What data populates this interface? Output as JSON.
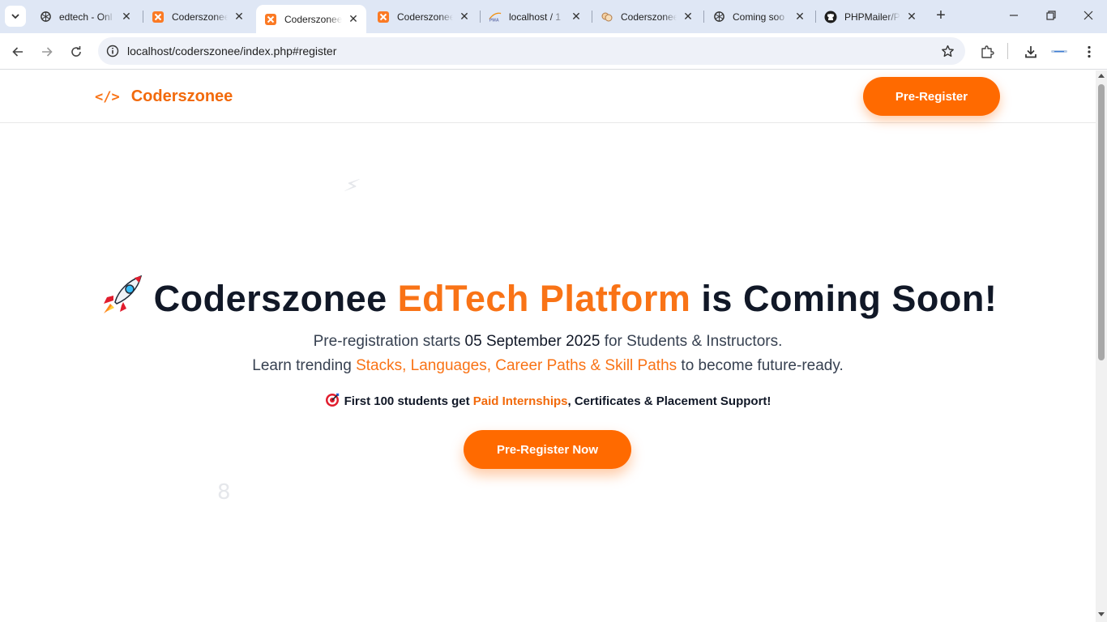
{
  "browser": {
    "tabs": [
      {
        "title": "edtech - Onl",
        "icon": "chatgpt-icon",
        "active": false
      },
      {
        "title": "Coderszonee",
        "icon": "xampp-icon",
        "active": false
      },
      {
        "title": "Coderszonee",
        "icon": "xampp-icon",
        "active": true
      },
      {
        "title": "Coderszonee",
        "icon": "xampp-icon",
        "active": false
      },
      {
        "title": "localhost / 1",
        "icon": "phpmyadmin-icon",
        "active": false
      },
      {
        "title": "Coderszonee",
        "icon": "brain-icon",
        "active": false
      },
      {
        "title": "Coming soo",
        "icon": "chatgpt-icon",
        "active": false
      },
      {
        "title": "PHPMailer/P",
        "icon": "github-icon",
        "active": false
      }
    ],
    "new_tab": "+",
    "url": "localhost/coderszonee/index.php#register"
  },
  "navbar": {
    "brand_icon": "</>",
    "brand_name": "Coderszonee",
    "cta": "Pre-Register"
  },
  "hero": {
    "title_prefix": "Coderszonee ",
    "title_accent": "EdTech Platform",
    "title_suffix": " is Coming Soon!",
    "line1_pre": "Pre-registration starts ",
    "line1_date": "05 September 2025",
    "line1_post": " for Students & Instructors.",
    "line2_pre": "Learn trending ",
    "line2_accent": "Stacks, Languages, Career Paths & Skill Paths",
    "line2_post": " to become future-ready.",
    "perk_pre": "First 100 students get ",
    "perk_accent": "Paid Internships",
    "perk_post": ", Certificates & Placement Support!",
    "cta": "Pre-Register Now"
  },
  "colors": {
    "accent": "#ff6a00",
    "heading": "#111827",
    "tabstrip": "#dfe7f5"
  }
}
